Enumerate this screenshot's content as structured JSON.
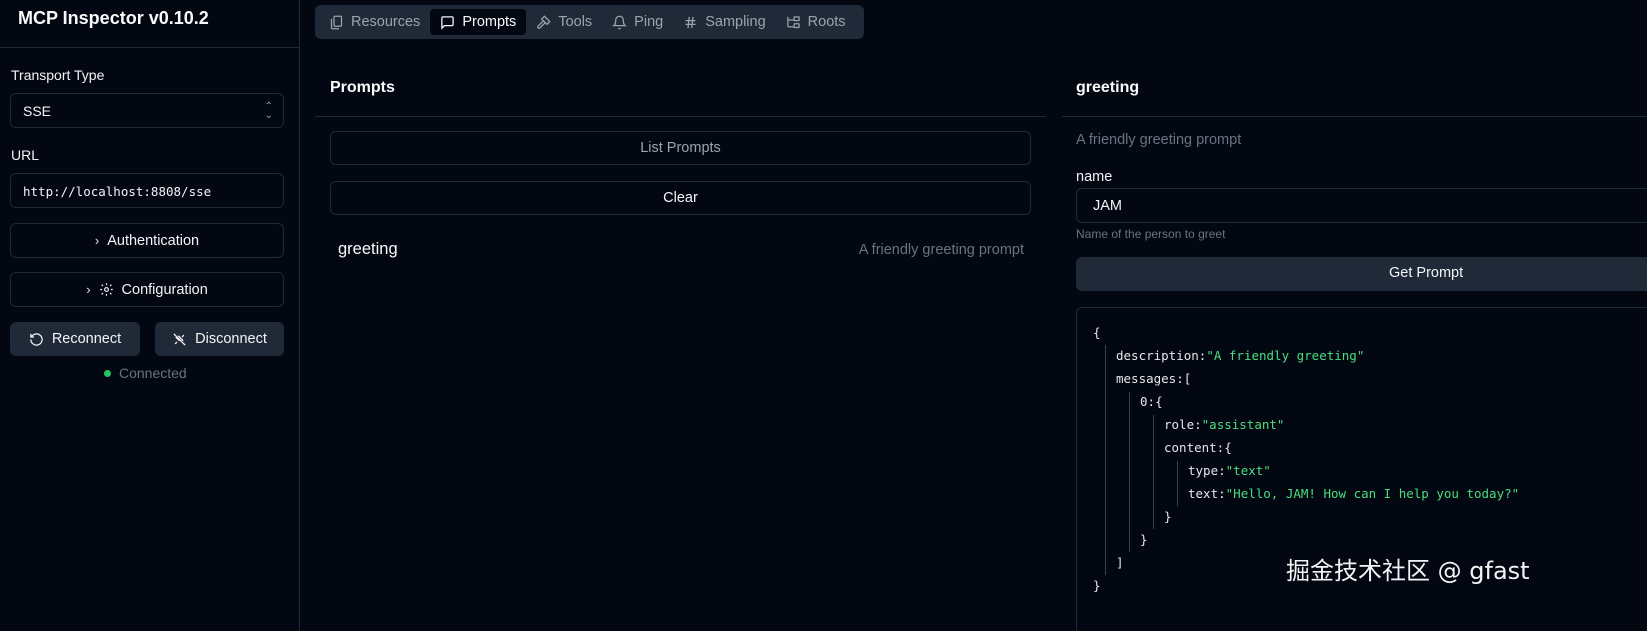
{
  "app": {
    "title": "MCP Inspector v0.10.2"
  },
  "sidebar": {
    "transport_label": "Transport Type",
    "transport_value": "SSE",
    "url_label": "URL",
    "url_value": "http://localhost:8808/sse",
    "authentication_label": "Authentication",
    "configuration_label": "Configuration",
    "reconnect_label": "Reconnect",
    "disconnect_label": "Disconnect",
    "status_text": "Connected",
    "status_color": "#22c55e"
  },
  "tabs": [
    {
      "label": "Resources",
      "icon": "files-icon",
      "active": false
    },
    {
      "label": "Prompts",
      "icon": "message-square-icon",
      "active": true
    },
    {
      "label": "Tools",
      "icon": "hammer-icon",
      "active": false
    },
    {
      "label": "Ping",
      "icon": "bell-icon",
      "active": false
    },
    {
      "label": "Sampling",
      "icon": "hash-icon",
      "active": false
    },
    {
      "label": "Roots",
      "icon": "folder-tree-icon",
      "active": false
    }
  ],
  "prompts_panel": {
    "title": "Prompts",
    "list_button": "List Prompts",
    "clear_button": "Clear",
    "items": [
      {
        "name": "greeting",
        "description": "A friendly greeting prompt"
      }
    ]
  },
  "detail_panel": {
    "title": "greeting",
    "description": "A friendly greeting prompt",
    "arg_label": "name",
    "arg_value": "JAM",
    "arg_help": "Name of the person to greet",
    "get_button": "Get Prompt",
    "result": {
      "open_brace": "{",
      "description_key": "description:",
      "description_value": "\"A friendly greeting\"",
      "messages_key": "messages:",
      "messages_open": "[",
      "index_key": "0:",
      "index_open": "{",
      "role_key": "role:",
      "role_value": "\"assistant\"",
      "content_key": "content:",
      "content_open": "{",
      "type_key": "type:",
      "type_value": "\"text\"",
      "text_key": "text:",
      "text_value": "\"Hello, JAM! How can I help you today?\"",
      "content_close": "}",
      "index_close": "}",
      "messages_close": "]",
      "close_brace": "}"
    }
  },
  "watermark": "掘金技术社区 @ gfast"
}
